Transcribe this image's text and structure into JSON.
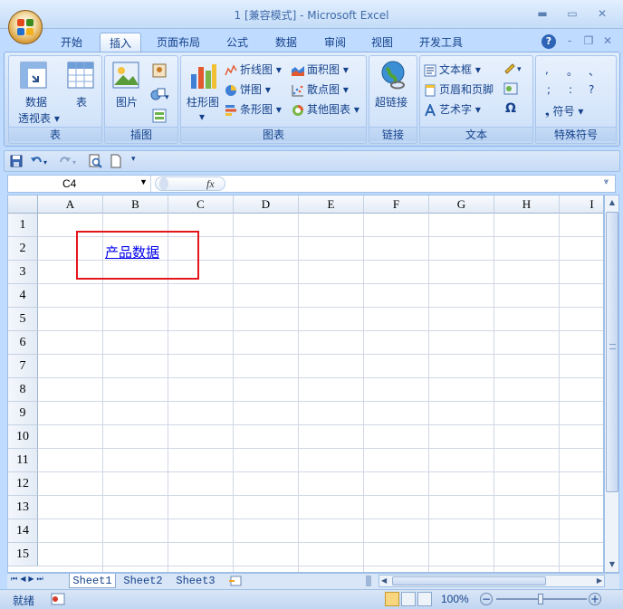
{
  "window": {
    "title": "1  [兼容模式] - Microsoft Excel"
  },
  "tabs": [
    "开始",
    "插入",
    "页面布局",
    "公式",
    "数据",
    "审阅",
    "视图",
    "开发工具"
  ],
  "active_tab": "插入",
  "ribbon": {
    "groups": {
      "tables": {
        "label": "表",
        "pivot_label_1": "数据",
        "pivot_label_2": "透视表",
        "table_label": "表"
      },
      "illustrations": {
        "label": "插图",
        "picture_label": "图片"
      },
      "charts": {
        "label": "图表",
        "column_label": "柱形图",
        "line_label": "折线图",
        "pie_label": "饼图",
        "bar_label": "条形图",
        "area_label": "面积图",
        "scatter_label": "散点图",
        "other_label": "其他图表"
      },
      "links": {
        "label": "链接",
        "hyperlink_label": "超链接"
      },
      "text": {
        "label": "文本",
        "textbox_label": "文本框",
        "header_footer_label": "页眉和页脚",
        "wordart_label": "艺术字"
      },
      "symbols": {
        "label": "特殊符号",
        "symbol_label": "符号",
        "chars": [
          ",",
          "。",
          "、",
          ";",
          ":",
          "?"
        ]
      }
    }
  },
  "formula_bar": {
    "name_box": "C4",
    "fx": "fx",
    "formula": ""
  },
  "grid": {
    "columns": [
      "A",
      "B",
      "C",
      "D",
      "E",
      "F",
      "G",
      "H",
      "I"
    ],
    "rows": [
      "1",
      "2",
      "3",
      "4",
      "5",
      "6",
      "7",
      "8",
      "9",
      "10",
      "11",
      "12",
      "13",
      "14",
      "15"
    ],
    "cell_B2": "产品数据"
  },
  "sheets": [
    "Sheet1",
    "Sheet2",
    "Sheet3"
  ],
  "active_sheet": "Sheet1",
  "status": {
    "mode": "就绪",
    "zoom": "100%"
  },
  "colors": {
    "accent_red": "#e4161b",
    "hyperlink": "#0000ee"
  }
}
